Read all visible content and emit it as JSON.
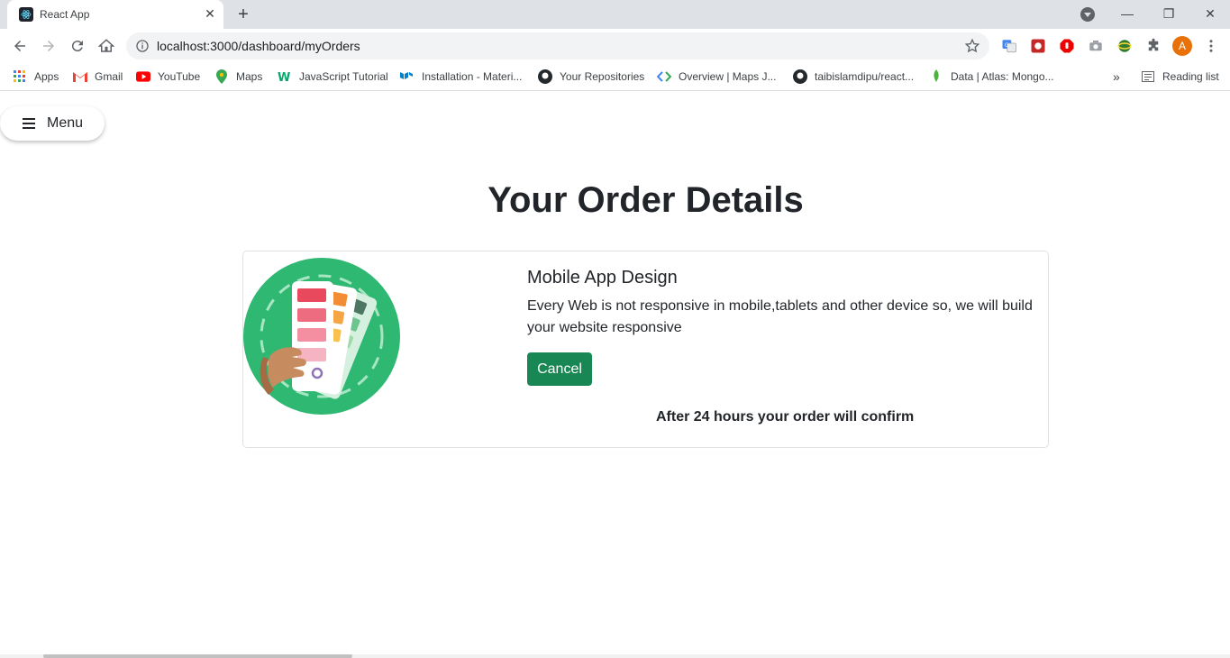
{
  "browser": {
    "tab_title": "React App",
    "url": "localhost:3000/dashboard/myOrders",
    "profile_initial": "A",
    "bookmarks": [
      {
        "label": "Apps",
        "icon": "apps-grid-icon"
      },
      {
        "label": "Gmail",
        "icon": "gmail-icon"
      },
      {
        "label": "YouTube",
        "icon": "youtube-icon"
      },
      {
        "label": "Maps",
        "icon": "maps-icon"
      },
      {
        "label": "JavaScript Tutorial",
        "icon": "w3schools-icon"
      },
      {
        "label": "Installation - Materi...",
        "icon": "material-ui-icon"
      },
      {
        "label": "Your Repositories",
        "icon": "github-icon"
      },
      {
        "label": "Overview | Maps J...",
        "icon": "maps-api-icon"
      },
      {
        "label": "taibislamdipu/react...",
        "icon": "github-icon"
      },
      {
        "label": "Data | Atlas: Mongo...",
        "icon": "mongodb-icon"
      }
    ],
    "more_bookmarks": "»",
    "reading_list": "Reading list"
  },
  "page": {
    "menu_label": "Menu",
    "title": "Your Order Details",
    "order": {
      "title": "Mobile App Design",
      "description": "Every Web is not responsive in mobile,tablets and other device so, we will build your website responsive",
      "cancel_label": "Cancel",
      "note": "After 24 hours your order will confirm"
    }
  },
  "colors": {
    "accent_green": "#198754",
    "image_green": "#2eb872",
    "avatar_orange": "#e8710a"
  }
}
